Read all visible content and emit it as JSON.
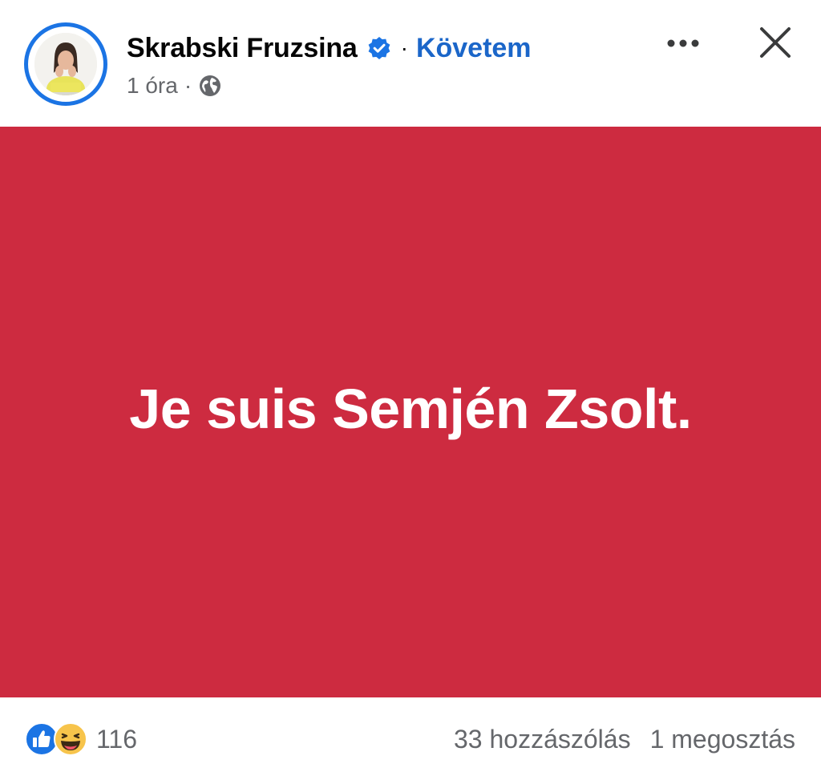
{
  "header": {
    "author_name": "Skrabski Fruzsina",
    "separator": "·",
    "follow_label": "Követem",
    "timestamp": "1 óra",
    "meta_separator": "·",
    "icons": {
      "verified": "verified-badge-icon",
      "audience": "globe-icon",
      "more": "more-options-icon",
      "close": "close-icon"
    }
  },
  "post": {
    "text": "Je suis Semjén Zsolt.",
    "background_color": "#cd2b40"
  },
  "footer": {
    "reaction_icons": [
      "like-icon",
      "haha-icon"
    ],
    "reaction_count": "116",
    "comments": "33 hozzászólás",
    "shares": "1 megosztás"
  },
  "colors": {
    "accent": "#1b74e4",
    "link": "#1b66c9",
    "muted": "#65676b"
  }
}
